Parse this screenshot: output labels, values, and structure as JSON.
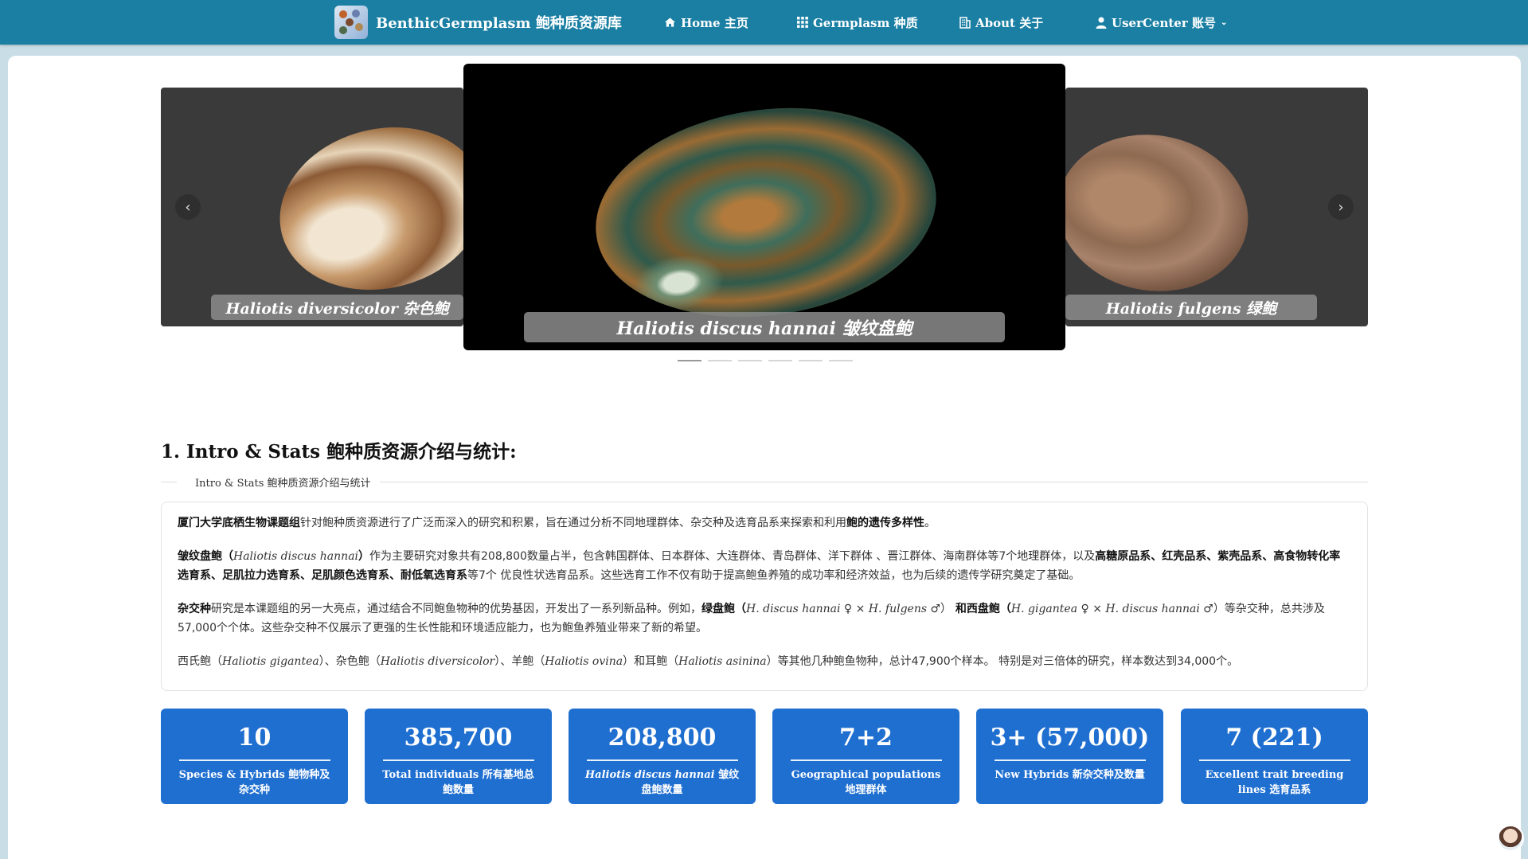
{
  "nav": {
    "brand": "BenthicGermplasm 鲍种质资源库",
    "items": [
      {
        "label": "Home 主页",
        "icon": "home-icon"
      },
      {
        "label": "Germplasm 种质",
        "icon": "grid-icon"
      },
      {
        "label": "About 关于",
        "icon": "building-icon"
      },
      {
        "label": "UserCenter 账号",
        "icon": "user-icon"
      }
    ],
    "color": "#1a7fa3"
  },
  "carousel": {
    "left_caption": "Haliotis diversicolor 杂色鲍",
    "center_caption": "Haliotis discus hannai 皱纹盘鲍",
    "right_caption": "Haliotis fulgens 绿鲍",
    "prev_arrow": "‹",
    "next_arrow": "›",
    "slide_count": 6,
    "active_index": 0
  },
  "section": {
    "title": "1. Intro & Stats 鲍种质资源介绍与统计:",
    "subtitle": "Intro & Stats 鲍种质资源介绍与统计"
  },
  "intro": {
    "p1": {
      "a": "厦门大学底栖生物课题组",
      "b": "针对鲍种质资源进行了广泛而深入的研究和积累，旨在通过分析不同地理群体、杂交种及选育品系来探索和利用",
      "c": "鲍的遗传多样性",
      "d": "。"
    },
    "p2": {
      "a": "皱纹盘鲍（",
      "b": "Haliotis discus hannai",
      "c": "）",
      "d": "作为主要研究对象共有208,800数量占半，包含韩国群体、日本群体、大连群体、青岛群体、洋下群体 、晋江群体、海南群体等7个地理群体，以及",
      "e": "高糖原品系、红壳品系、紫壳品系、高食物转化率选育系、足肌拉力选育系、足肌颜色选育系、耐低氧选育系",
      "f": "等7个 优良性状选育品系。这些选育工作不仅有助于提高鲍鱼养殖的成功率和经济效益，也为后续的遗传学研究奠定了基础。"
    },
    "p3": {
      "a": "杂交种",
      "b": "研究是本课题组的另一大亮点，通过结合不同鲍鱼物种的优势基因，开发出了一系列新品种。例如，",
      "c": "绿盘鲍（",
      "d": "H. discus hannai",
      "e": " ♀ × ",
      "f": "H. fulgens",
      "g": " ♂）",
      "h": " 和西盘鲍（",
      "i": "H. gigantea",
      "j": " ♀ × ",
      "k": "H. discus hannai",
      "l": " ♂）",
      "m": "等杂交种，总共涉及57,000个个体。这些杂交种不仅展示了更强的生长性能和环境适应能力，也为鲍鱼养殖业带来了新的希望。"
    },
    "p4": {
      "a": "西氏鲍（",
      "b": "Haliotis gigantea",
      "c": "）、杂色鲍（",
      "d": "Haliotis diversicolor",
      "e": "）、羊鲍（",
      "f": "Haliotis ovina",
      "g": "）和耳鲍（",
      "h": "Haliotis asinina",
      "i": "）等其他几种鲍鱼物种，总计47,900个样本。 特别是对三倍体的研究，样本数达到34,000个。"
    }
  },
  "stats": [
    {
      "value": "10",
      "label": "Species & Hybrids 鲍物种及杂交种"
    },
    {
      "value": "385,700",
      "label": "Total individuals 所有基地总鲍数量"
    },
    {
      "value": "208,800",
      "label_italic": "Haliotis discus hannai",
      "label": " 皱纹盘鲍数量"
    },
    {
      "value": "7+2",
      "label": "Geographical populations 地理群体"
    },
    {
      "value": "3+ (57,000)",
      "label": "New Hybrids 新杂交种及数量"
    },
    {
      "value": "7 (221)",
      "label": "Excellent trait breeding lines 选育品系"
    }
  ],
  "colors": {
    "stat_card": "#1f6fd1",
    "nav": "#1a7fa3"
  }
}
